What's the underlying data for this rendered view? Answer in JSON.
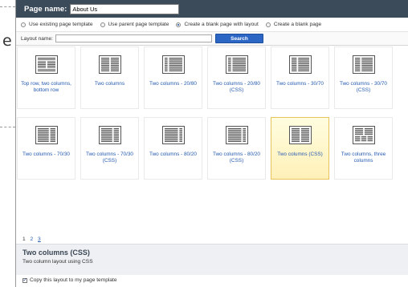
{
  "left_remnant": {
    "text": "e"
  },
  "header": {
    "label": "Page name:",
    "page_name_value": "About Us"
  },
  "options": [
    {
      "label": "Use existing page template",
      "selected": false
    },
    {
      "label": "Use parent page template",
      "selected": false
    },
    {
      "label": "Create a blank page with layout",
      "selected": true
    },
    {
      "label": "Create a blank page",
      "selected": false
    }
  ],
  "search": {
    "label": "Layout name:",
    "value": "",
    "button": "Search"
  },
  "layouts": [
    {
      "label": "Top row, two columns, bottom row",
      "layout": "top-two-bottom",
      "selected": false
    },
    {
      "label": "Two columns",
      "layout": "two-equal",
      "selected": false
    },
    {
      "label": "Two columns - 20/80",
      "layout": "20-80",
      "selected": false
    },
    {
      "label": "Two columns - 20/80 (CSS)",
      "layout": "20-80",
      "selected": false
    },
    {
      "label": "Two columns - 30/70",
      "layout": "30-70",
      "selected": false
    },
    {
      "label": "Two columns - 30/70 (CSS)",
      "layout": "30-70",
      "selected": false
    },
    {
      "label": "Two columns - 70/30",
      "layout": "70-30",
      "selected": false
    },
    {
      "label": "Two columns - 70/30 (CSS)",
      "layout": "70-30",
      "selected": false
    },
    {
      "label": "Two columns - 80/20",
      "layout": "80-20",
      "selected": false
    },
    {
      "label": "Two columns - 80/20 (CSS)",
      "layout": "80-20",
      "selected": false
    },
    {
      "label": "Two columns (CSS)",
      "layout": "two-equal",
      "selected": true
    },
    {
      "label": "Two columns, three columns",
      "layout": "two-three",
      "selected": false
    }
  ],
  "pager": {
    "pages": [
      "1",
      "2",
      "3"
    ],
    "current": "1"
  },
  "selected_layout": {
    "title": "Two columns (CSS)",
    "description": "Two column layout using CSS"
  },
  "copy_option": {
    "label": "Copy this layout to my page template",
    "checked": true
  },
  "colors": {
    "header_bg": "#3c4b5a",
    "link": "#245ab0",
    "button": "#2b66c4",
    "selected_tile": "#fff0b8"
  }
}
